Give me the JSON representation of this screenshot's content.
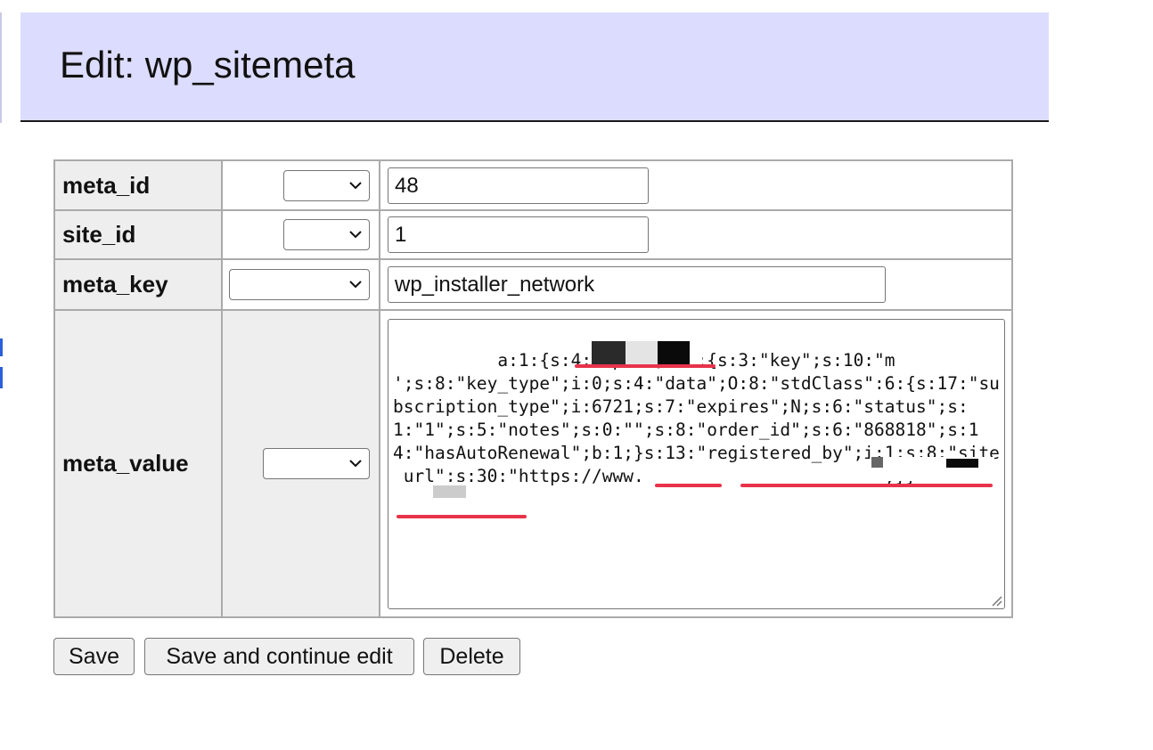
{
  "page": {
    "title": "Edit: wp_sitemeta"
  },
  "form": {
    "rows": [
      {
        "field": "meta_id",
        "operator": "",
        "value": "48"
      },
      {
        "field": "site_id",
        "operator": "",
        "value": "1"
      },
      {
        "field": "meta_key",
        "operator": "",
        "value": "wp_installer_network"
      },
      {
        "field": "meta_value",
        "operator": "",
        "value": "a:1:{s:4:\"wpml\";a:5:{s:3:\"key\";s:10:\"m          ';s:8:\"key_type\";i:0;s:4:\"data\";O:8:\"stdClass\":6:{s:17:\"subscription_type\";i:6721;s:7:\"expires\";N;s:6:\"status\";s:1:\"1\";s:5:\"notes\";s:0:\"\";s:8:\"order_id\";s:6:\"868818\";s:14:\"hasAutoRenewal\";b:1;}s:13:\"registered_by\";i:1;s:8:\"site_url\";s:30:\"https://www.                      \";}}"
      }
    ]
  },
  "buttons": {
    "save": "Save",
    "save_continue": "Save and continue edit",
    "delete": "Delete"
  },
  "icons": {
    "select_arrow": "chevron-down-icon",
    "textarea_resize": "resize-grip-icon"
  },
  "colors": {
    "header_background": "#dcdcff",
    "label_cell_background": "#eeeeee",
    "annotation_red": "#e8334a"
  }
}
